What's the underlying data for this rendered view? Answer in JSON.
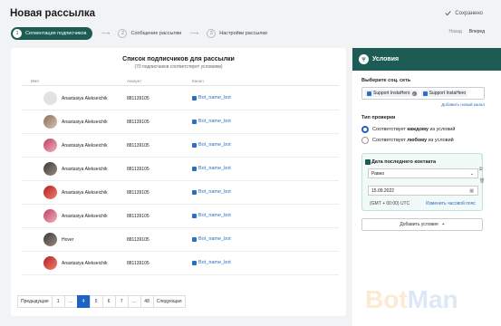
{
  "header": {
    "title": "Новая рассылка",
    "saved": "Сохранено",
    "back": "Назад",
    "forward": "Вперед"
  },
  "steps": [
    {
      "num": "1",
      "label": "Сегментация подписчиков"
    },
    {
      "num": "2",
      "label": "Сообщение рассылки"
    },
    {
      "num": "3",
      "label": "Настройки рассылки"
    }
  ],
  "list": {
    "title": "Список подписчиков для рассылки",
    "subtitle": "(70 подписчиков соответствует условиям)",
    "columns": [
      "Имя",
      "Аккаунт",
      "Канал"
    ],
    "rows": [
      {
        "name": "Anastasiya Alekseichik",
        "account": "881139105",
        "channel": "Bot_name_bot",
        "avatar": "placeholder"
      },
      {
        "name": "Anastasiya Alekseichik",
        "account": "881139105",
        "channel": "Bot_name_bot",
        "avatar": "photo"
      },
      {
        "name": "Anastasiya Alekseichik",
        "account": "881139105",
        "channel": "Bot_name_bot",
        "avatar": "photo-pink"
      },
      {
        "name": "Anastasiya Alekseichik",
        "account": "881139105",
        "channel": "Bot_name_bot",
        "avatar": "photo-dark"
      },
      {
        "name": "Anastasiya Alekseichik",
        "account": "881139105",
        "channel": "Bot_name_bot",
        "avatar": "photo-red"
      },
      {
        "name": "Anastasiya Alekseichik",
        "account": "881139105",
        "channel": "Bot_name_bot",
        "avatar": "photo-pink"
      },
      {
        "name": "Hover",
        "account": "881139105",
        "channel": "Bot_name_bot",
        "avatar": "photo-dark"
      },
      {
        "name": "Anastasiya Alekseichik",
        "account": "881139105",
        "channel": "Bot_name_bot",
        "avatar": "photo-red"
      }
    ]
  },
  "pagination": {
    "prev": "Предыдущая",
    "pages": [
      "1",
      "...",
      "4",
      "5",
      "6",
      "7",
      "...",
      "48"
    ],
    "active": "4",
    "next": "Следующая"
  },
  "conditions": {
    "title": "Условия",
    "social_label": "Выберите соц. сеть",
    "chips": [
      "Support InstaHero",
      "Support InstaHero"
    ],
    "add_channel": "Добавить новый канал",
    "check_type": "Тип проверки",
    "radio_each_pre": "Соответствует ",
    "radio_each_bold": "каждому",
    "radio_each_post": " из условий",
    "radio_any_pre": "Соответствует ",
    "radio_any_bold": "любому",
    "radio_any_post": " из условий",
    "cond_title": "Дата последнего контакта",
    "cond_operator": "Равно",
    "cond_date": "15.09.2022",
    "timezone": "(GMT + 00:00) UTC",
    "change_tz": "Изменить часовой пояс",
    "add_condition": "Добавить условие",
    "brand_a": "Bot",
    "brand_b": "Man"
  },
  "colors": {
    "accent": "#1d5c54",
    "link": "#2b6fc4",
    "active_page": "#1e62c4"
  }
}
